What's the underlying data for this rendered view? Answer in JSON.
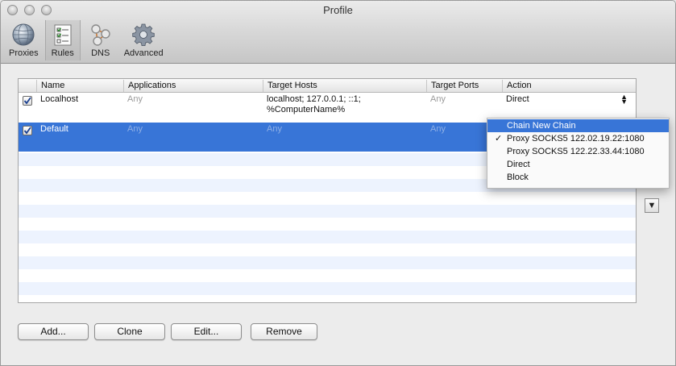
{
  "window": {
    "title": "Profile"
  },
  "toolbar": {
    "items": [
      {
        "label": "Proxies",
        "icon": "globe-icon"
      },
      {
        "label": "Rules",
        "icon": "checklist-icon",
        "selected": true
      },
      {
        "label": "DNS",
        "icon": "network-icon"
      },
      {
        "label": "Advanced",
        "icon": "gear-icon"
      }
    ]
  },
  "table": {
    "headers": [
      "Name",
      "Applications",
      "Target Hosts",
      "Target Ports",
      "Action"
    ],
    "rows": [
      {
        "checked": true,
        "name": "Localhost",
        "applications": "Any",
        "hosts_line1": "localhost; 127.0.0.1; ::1;",
        "hosts_line2": "%ComputerName%",
        "ports": "Any",
        "action": "Direct"
      },
      {
        "checked": true,
        "name": "Default",
        "applications": "Any",
        "hosts_line1": "Any",
        "hosts_line2": "",
        "ports": "Any",
        "action": ""
      }
    ]
  },
  "action_menu": {
    "items": [
      {
        "label": "Chain New Chain",
        "highlighted": true
      },
      {
        "label": "Proxy SOCKS5 122.02.19.22:1080",
        "checked": true
      },
      {
        "label": "Proxy SOCKS5 122.22.33.44:1080"
      },
      {
        "label": "Direct"
      },
      {
        "label": "Block"
      }
    ],
    "check_mark": "✓"
  },
  "buttons": {
    "add": "Add...",
    "clone": "Clone",
    "edit": "Edit...",
    "remove": "Remove"
  },
  "colors": {
    "selection": "#3875d7",
    "stripe": "#edf3fe"
  }
}
